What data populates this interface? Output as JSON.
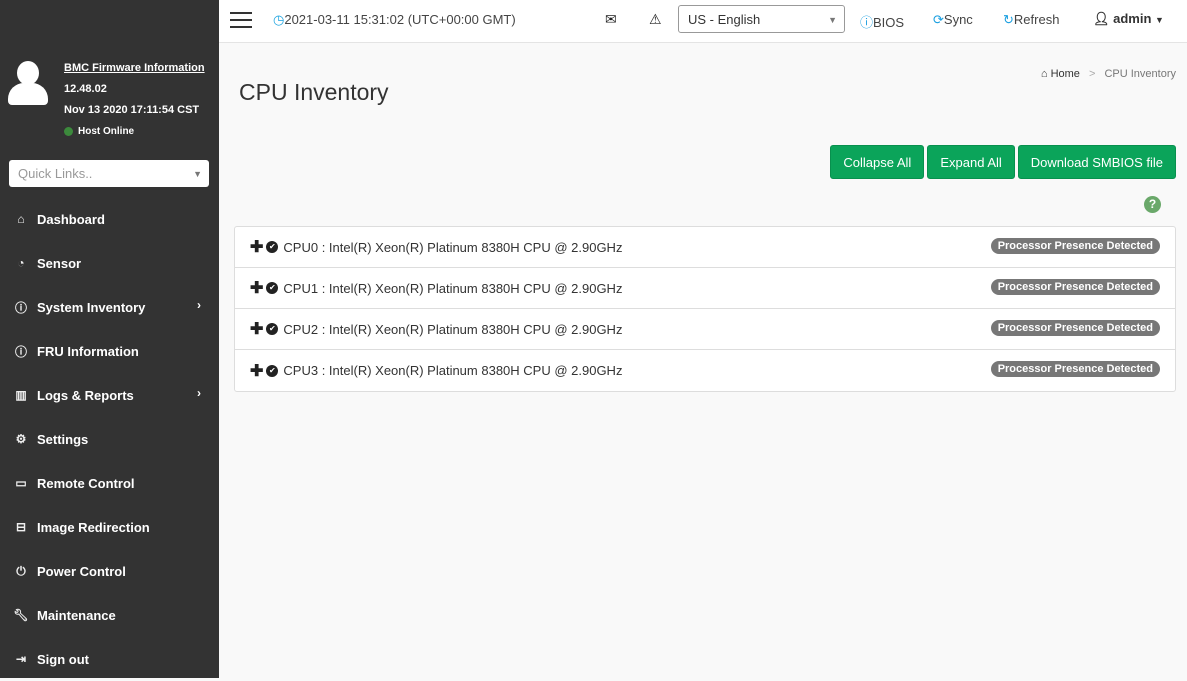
{
  "sidebar": {
    "firmware_link": "BMC Firmware Information",
    "version": "12.48.02",
    "build_date": "Nov 13 2020 17:11:54 CST",
    "host_status": "Host Online",
    "quick_links_placeholder": "Quick Links..",
    "items": [
      {
        "label": "Dashboard"
      },
      {
        "label": "Sensor"
      },
      {
        "label": "System Inventory"
      },
      {
        "label": "FRU Information"
      },
      {
        "label": "Logs & Reports"
      },
      {
        "label": "Settings"
      },
      {
        "label": "Remote Control"
      },
      {
        "label": "Image Redirection"
      },
      {
        "label": "Power Control"
      },
      {
        "label": "Maintenance"
      },
      {
        "label": "Sign out"
      }
    ]
  },
  "header": {
    "datetime": "2021-03-11 15:31:02 (UTC+00:00 GMT)",
    "language": "US - English",
    "bios": "BIOS",
    "sync": "Sync",
    "refresh": "Refresh",
    "user": "admin"
  },
  "page": {
    "title": "CPU Inventory",
    "breadcrumb_home": "Home",
    "breadcrumb_sep": ">",
    "breadcrumb_current": "CPU Inventory",
    "collapse_all": "Collapse All",
    "expand_all": "Expand All",
    "download": "Download SMBIOS file",
    "help": "?"
  },
  "cpus": [
    {
      "label": "CPU0 : Intel(R) Xeon(R) Platinum 8380H CPU @ 2.90GHz",
      "status": "Processor Presence Detected"
    },
    {
      "label": "CPU1 : Intel(R) Xeon(R) Platinum 8380H CPU @ 2.90GHz",
      "status": "Processor Presence Detected"
    },
    {
      "label": "CPU2 : Intel(R) Xeon(R) Platinum 8380H CPU @ 2.90GHz",
      "status": "Processor Presence Detected"
    },
    {
      "label": "CPU3 : Intel(R) Xeon(R) Platinum 8380H CPU @ 2.90GHz",
      "status": "Processor Presence Detected"
    }
  ]
}
